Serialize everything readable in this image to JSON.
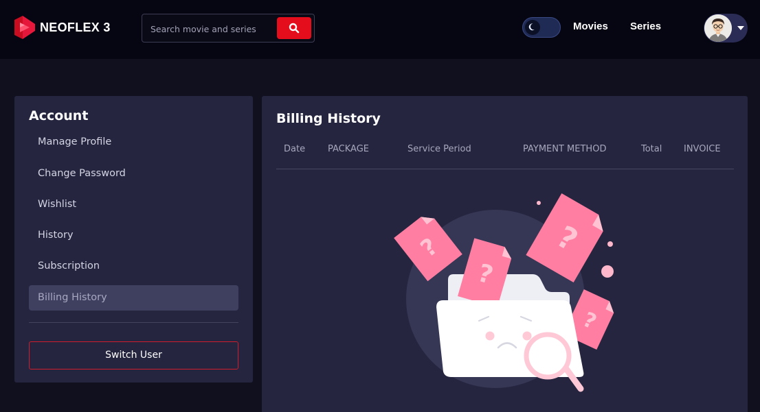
{
  "header": {
    "logo_text": "NEOFLEX 3",
    "search": {
      "placeholder": "Search movie and series",
      "value": ""
    },
    "theme_toggle": {
      "mode": "dark",
      "icon": "moon-icon"
    },
    "nav": [
      {
        "label": "Movies"
      },
      {
        "label": "Series"
      }
    ],
    "user_menu": {
      "icon": "chevron-down-icon"
    }
  },
  "sidebar": {
    "title": "Account",
    "items": [
      {
        "label": "Manage Profile",
        "active": false
      },
      {
        "label": "Change Password",
        "active": false
      },
      {
        "label": "Wishlist",
        "active": false
      },
      {
        "label": "History",
        "active": false
      },
      {
        "label": "Subscription",
        "active": false
      },
      {
        "label": "Billing History",
        "active": true
      }
    ],
    "switch_user_label": "Switch User"
  },
  "main": {
    "title": "Billing History",
    "columns": [
      "Date",
      "PACKAGE",
      "Service Period",
      "PAYMENT METHOD",
      "Total",
      "INVOICE"
    ],
    "rows": [],
    "empty_state": {
      "illustration": "empty-folder-illustration"
    }
  },
  "colors": {
    "accent": "#e30d1c",
    "background": "#10101e",
    "header_bg": "#060612",
    "panel_bg": "#25253f",
    "active_item_bg": "#3f3f60",
    "illustration_pink": "#ff7ea1"
  }
}
